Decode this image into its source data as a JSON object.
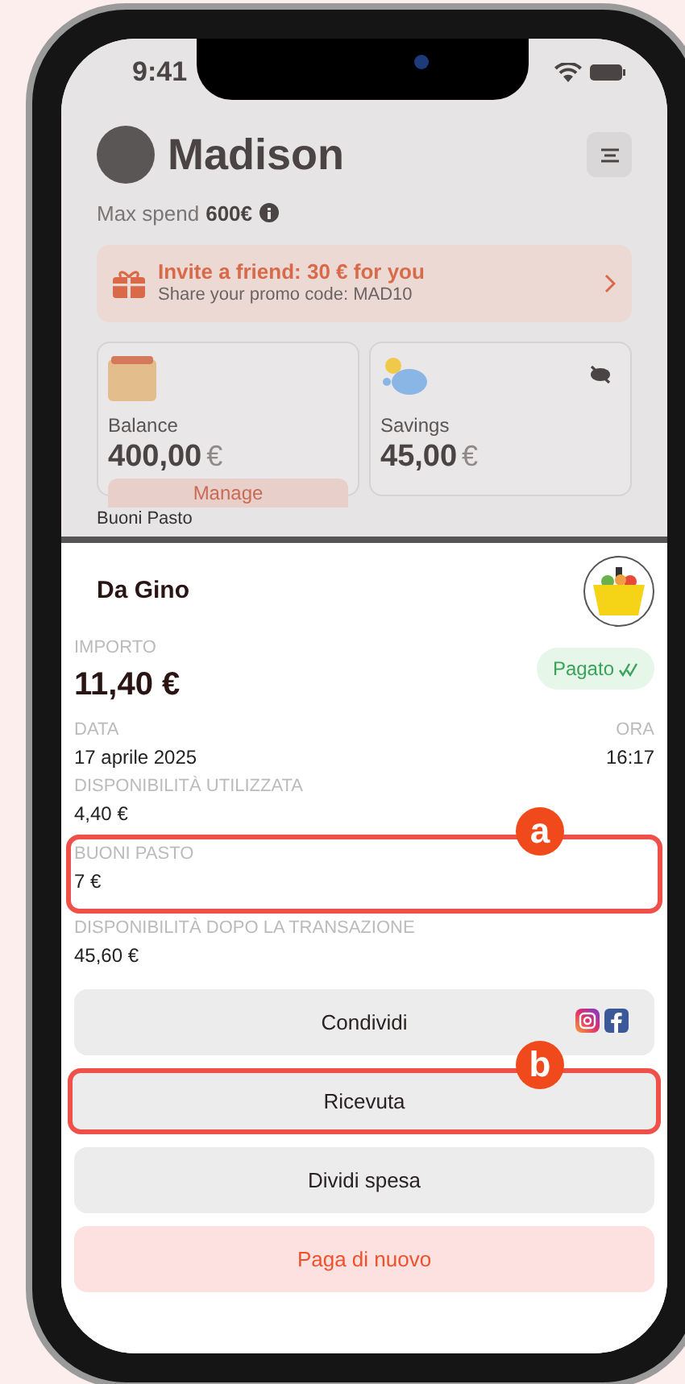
{
  "status_bar": {
    "time": "9:41"
  },
  "header": {
    "name": "Madison",
    "max_spend_label": "Max spend",
    "max_spend_value": "600€"
  },
  "promo": {
    "title": "Invite a friend: 30 € for you",
    "subtitle": "Share your promo code: MAD10"
  },
  "cards": [
    {
      "kind": "balance",
      "label": "Balance",
      "amount": "400,00",
      "currency": "€",
      "button": "Manage"
    },
    {
      "kind": "savings",
      "label": "Savings",
      "amount": "45,00",
      "currency": "€"
    }
  ],
  "peek_text": "Buoni Pasto",
  "sheet": {
    "merchant": "Da Gino",
    "amount": {
      "label": "IMPORTO",
      "value": "11,40 €"
    },
    "status": "Pagato",
    "date": {
      "label": "DATA",
      "value": "17 aprile 2025"
    },
    "time": {
      "label": "ORA",
      "value": "16:17"
    },
    "details": [
      {
        "label": "DISPONIBILITÀ UTILIZZATA",
        "value": "4,40 €",
        "highlighted": false
      },
      {
        "label": "BUONI PASTO",
        "value": "7 €",
        "highlighted": true,
        "callout": "a"
      },
      {
        "label": "DISPONIBILITÀ DOPO LA TRANSAZIONE",
        "value": "45,60 €",
        "highlighted": false
      }
    ],
    "buttons": [
      {
        "kind": "share",
        "label": "Condividi",
        "highlighted": false
      },
      {
        "kind": "plain",
        "label": "Ricevuta",
        "highlighted": true,
        "callout": "b"
      },
      {
        "kind": "plain",
        "label": "Dividi spesa",
        "highlighted": false
      },
      {
        "kind": "danger",
        "label": "Paga di nuovo",
        "highlighted": false
      }
    ]
  }
}
